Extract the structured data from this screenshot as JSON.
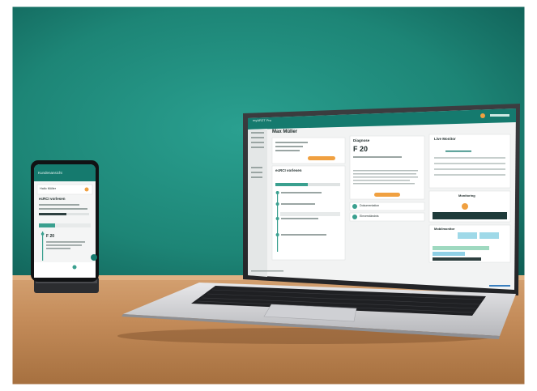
{
  "laptop": {
    "app_title": "myARZT Pro",
    "patient_name": "Max Müller",
    "diagnose_label": "Diagnose",
    "diagnose_code": "F 20",
    "live_monitor_label": "Live Monitor",
    "section_label": "ecRCI vorlesen",
    "dokumentation_label": "Dokumentation",
    "einverstaendnis_label": "Einverständnis",
    "monitoring_label": "Monitoring",
    "mobilmonitor_label": "Mobilmonitor"
  },
  "phone": {
    "app_title": "Kundenansicht",
    "greeting": "Hallo Müller",
    "section_label": "ecRCI vorlesen",
    "code": "F 20"
  },
  "colors": {
    "wall": "#1f8a7c",
    "wall_dark": "#0f5e55",
    "desk": "#c08a58",
    "app_teal": "#157a6e",
    "accent_orange": "#f0a040"
  }
}
